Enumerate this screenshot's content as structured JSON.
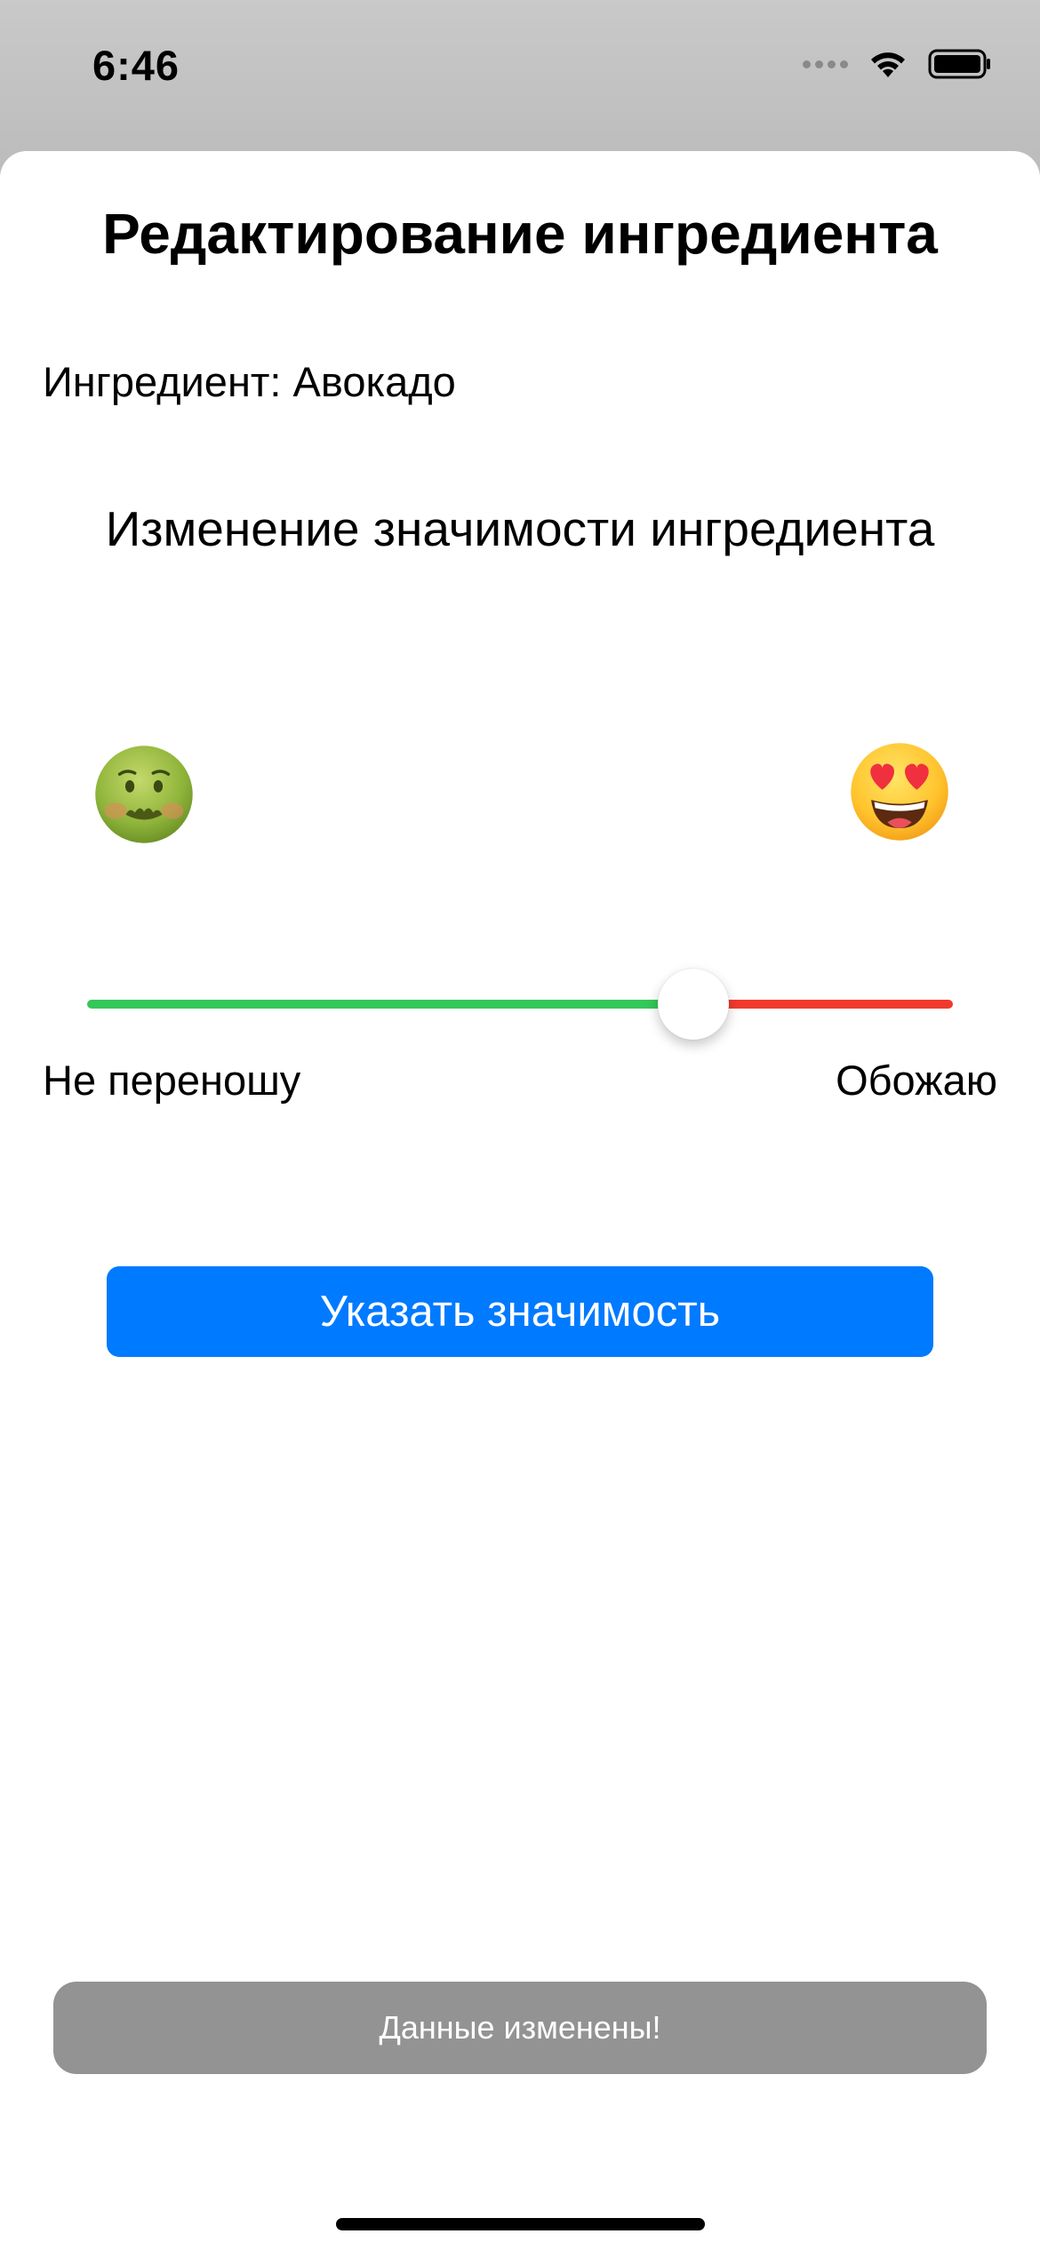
{
  "status_bar": {
    "time": "6:46",
    "icons": [
      "signal-dots-icon",
      "wifi-icon",
      "battery-icon"
    ]
  },
  "sheet": {
    "title": "Редактирование ингредиента",
    "ingredient_line": "Ингредиент: Авокадо",
    "subtitle": "Изменение значимости ингредиента",
    "emoji_left": "nauseated-face-icon",
    "emoji_right": "heart-eyes-face-icon",
    "slider": {
      "value": 0.7,
      "min_label": "Не переношу",
      "max_label": "Обожаю",
      "colors": {
        "min_track": "#34c759",
        "max_track": "#f03a2f"
      }
    },
    "submit_label": "Указать значимость",
    "toast_text": "Данные изменены!"
  },
  "colors": {
    "accent": "#007aff",
    "toast_bg": "#939393"
  }
}
